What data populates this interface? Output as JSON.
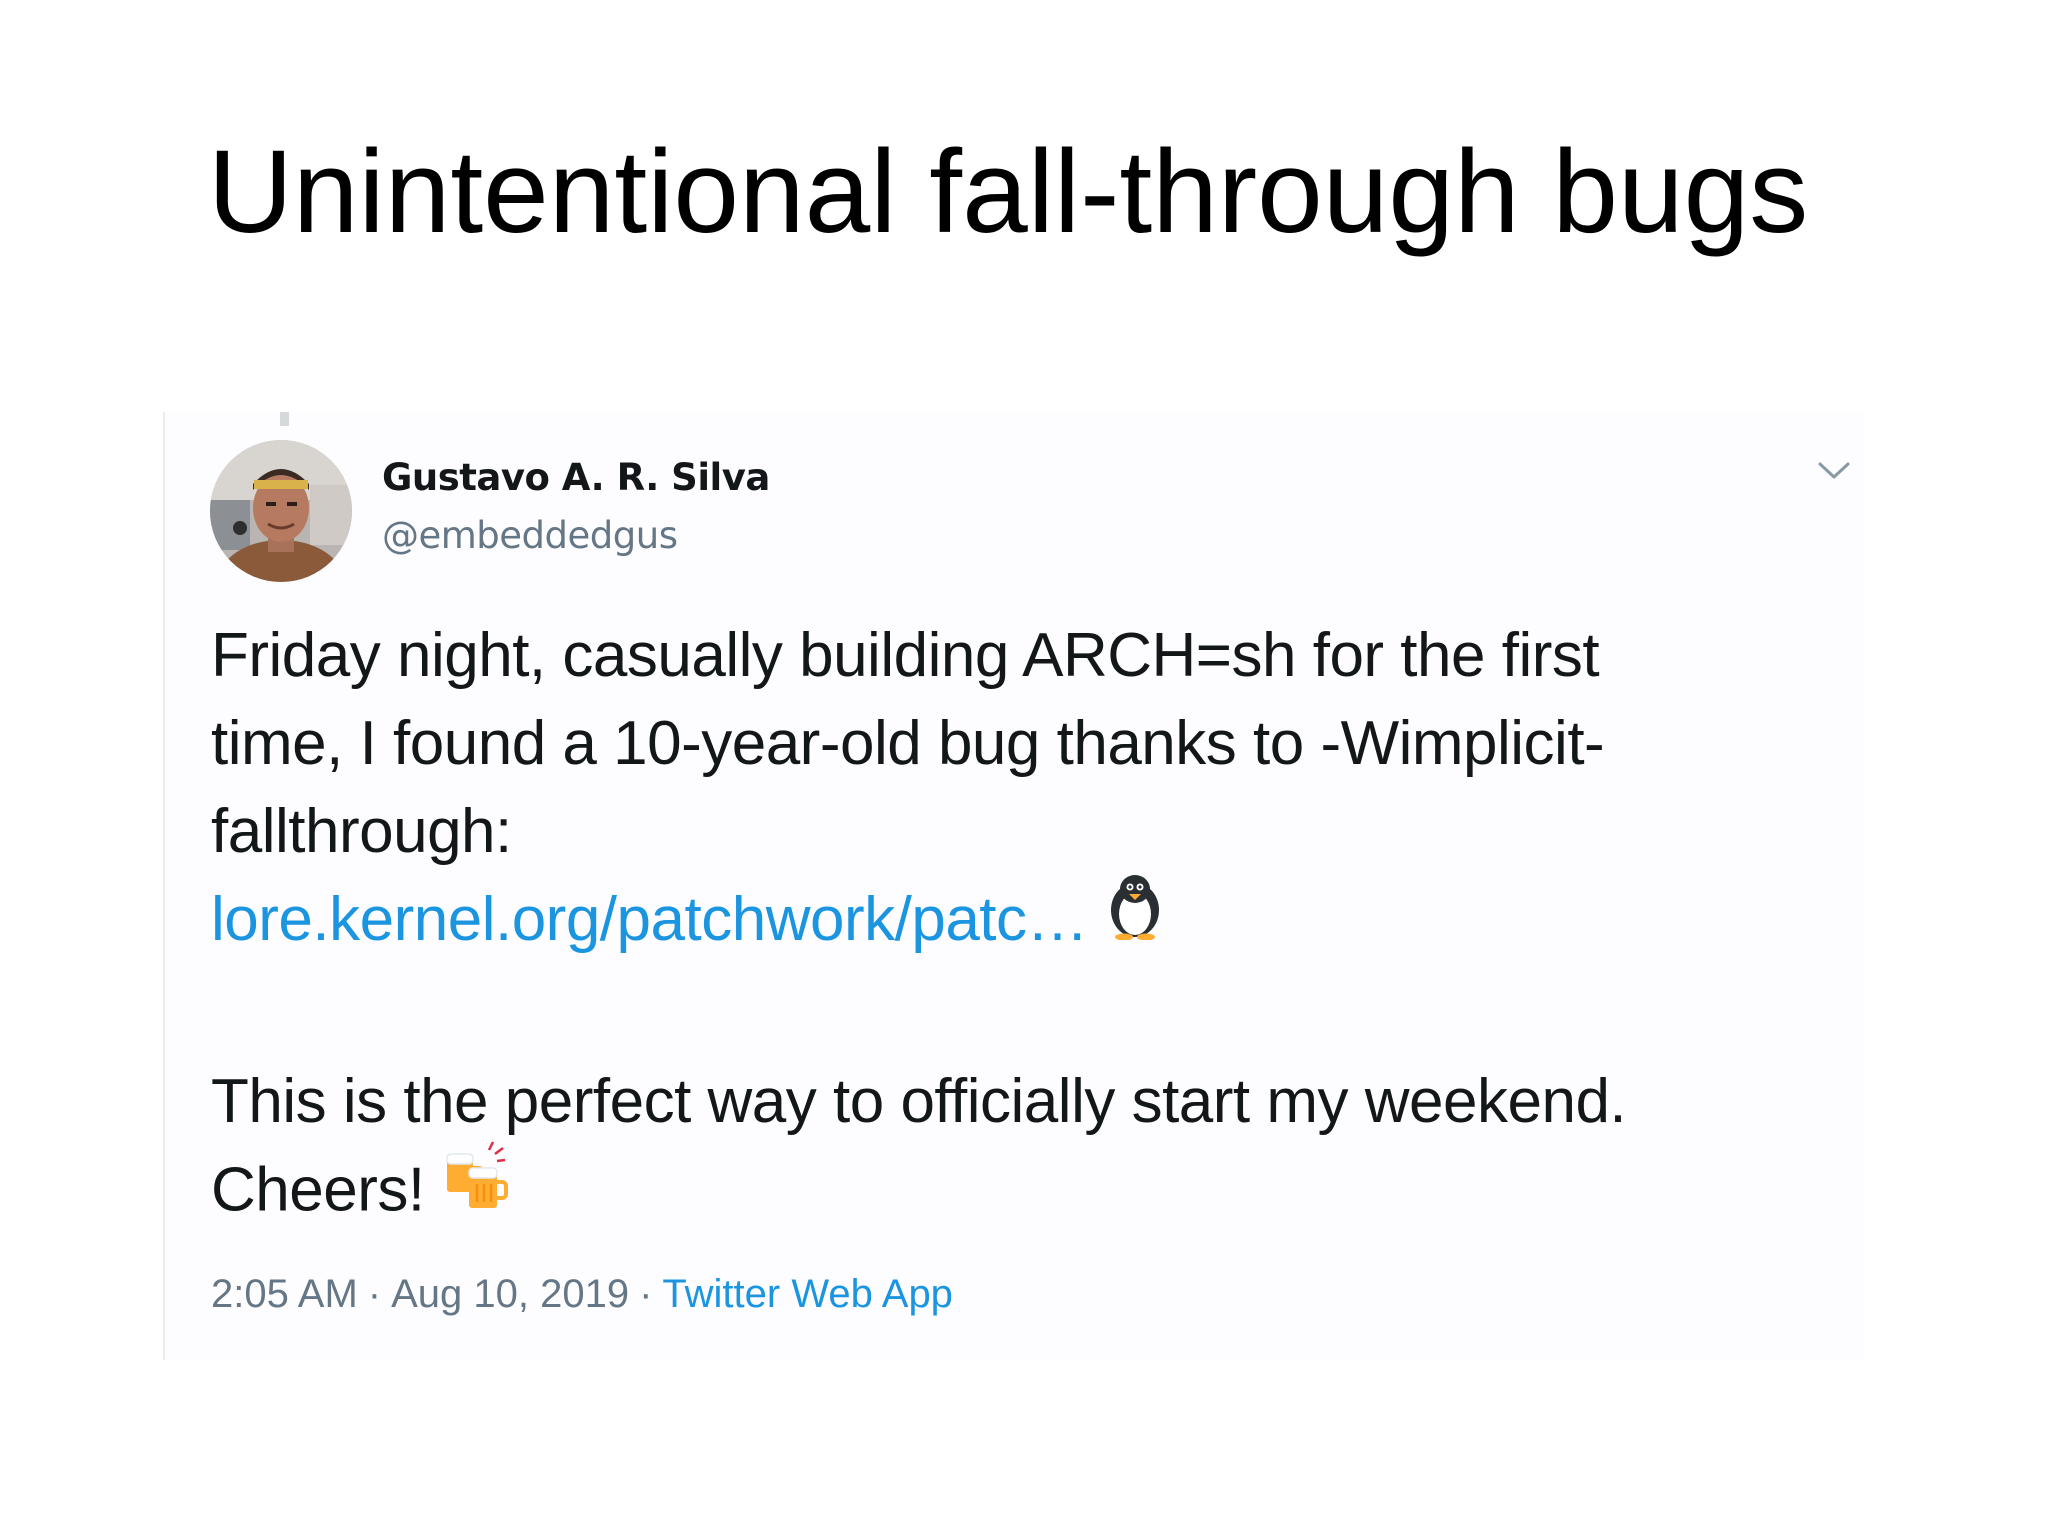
{
  "slide": {
    "title": "Unintentional fall-through bugs"
  },
  "tweet": {
    "author": {
      "display_name": "Gustavo A. R. Silva",
      "handle": "@embeddedgus",
      "avatar_icon": "profile-photo"
    },
    "menu_icon": "chevron-down-icon",
    "text_lines": [
      "Friday night, casually building ARCH=sh for the first",
      "time, I found a 10-year-old bug thanks to -Wimplicit-",
      "fallthrough:"
    ],
    "link_text": "lore.kernel.org/patchwork/patc…",
    "link_emoji": "penguin-emoji",
    "text_line_2a": "This is the perfect way to officially start my weekend.",
    "text_line_2b": "Cheers!",
    "cheers_emoji": "clinking-beer-mugs-emoji",
    "time": "2:05 AM",
    "date": "Aug 10, 2019",
    "separator": "·",
    "source": "Twitter Web App"
  },
  "colors": {
    "link": "#1b95e0",
    "text": "#14171a",
    "secondary": "#657786"
  }
}
